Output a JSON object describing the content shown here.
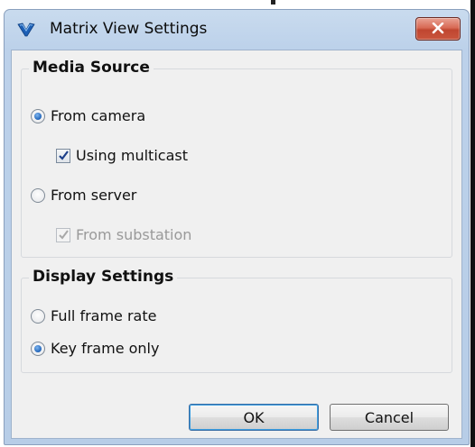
{
  "window": {
    "title": "Matrix View Settings",
    "icon": "v-logo-icon",
    "close_icon": "close-icon"
  },
  "media_source": {
    "title": "Media Source",
    "from_camera": {
      "label": "From camera",
      "selected": true
    },
    "using_multicast": {
      "label": "Using multicast",
      "checked": true,
      "enabled": true
    },
    "from_server": {
      "label": "From server",
      "selected": false
    },
    "from_substation": {
      "label": "From substation",
      "checked": true,
      "enabled": false
    }
  },
  "display_settings": {
    "title": "Display Settings",
    "full_frame_rate": {
      "label": "Full frame rate",
      "selected": false
    },
    "key_frame_only": {
      "label": "Key frame only",
      "selected": true
    }
  },
  "buttons": {
    "ok": "OK",
    "cancel": "Cancel"
  },
  "colors": {
    "title_bar": "#bcd1ea",
    "close_button": "#c9553d",
    "accent": "#1f63b8"
  }
}
